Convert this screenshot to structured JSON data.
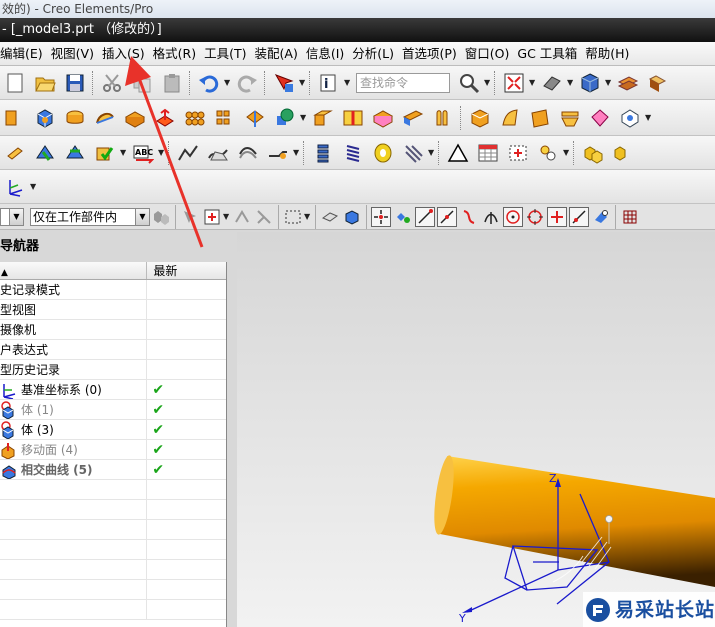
{
  "os_title": "效的) - Creo Elements/Pro",
  "doc_title": "- [_model3.prt （修改的）]",
  "menu": [
    "编辑(E)",
    "视图(V)",
    "插入(S)",
    "格式(R)",
    "工具(T)",
    "装配(A)",
    "信息(I)",
    "分析(L)",
    "首选项(P)",
    "窗口(O)",
    "GC 工具箱",
    "帮助(H)"
  ],
  "toolbar": {
    "search_placeholder": "查找命令"
  },
  "filter": {
    "scope_value": "仅在工作部件内"
  },
  "navigator": {
    "title": "导航器",
    "col_name": "",
    "col_latest": "最新",
    "rows": [
      {
        "label": "史记录模式",
        "style": "normal",
        "icon": "",
        "check": ""
      },
      {
        "label": "型视图",
        "style": "normal",
        "icon": "",
        "check": ""
      },
      {
        "label": "摄像机",
        "style": "normal",
        "icon": "",
        "check": ""
      },
      {
        "label": "户表达式",
        "style": "normal",
        "icon": "",
        "check": ""
      },
      {
        "label": "型历史记录",
        "style": "normal",
        "icon": "",
        "check": ""
      },
      {
        "label": "基准坐标系 (0)",
        "style": "normal",
        "icon": "datum-csys-icon",
        "check": "✔"
      },
      {
        "label": "体 (1)",
        "style": "dim",
        "icon": "body-icon",
        "check": "✔"
      },
      {
        "label": "体 (3)",
        "style": "normal",
        "icon": "body-icon",
        "check": "✔"
      },
      {
        "label": "移动面 (4)",
        "style": "dim",
        "icon": "move-face-icon",
        "check": "✔"
      },
      {
        "label": "相交曲线 (5)",
        "style": "bold",
        "icon": "intersect-curve-icon",
        "check": "✔"
      }
    ]
  },
  "viewport": {
    "axis_z": "Z",
    "axis_y": "Y"
  },
  "watermark": {
    "text": "易采站长站"
  },
  "colors": {
    "cylinder": "#f5a800",
    "axis_blue": "#1a1acc",
    "annotation_red": "#e8322a"
  }
}
